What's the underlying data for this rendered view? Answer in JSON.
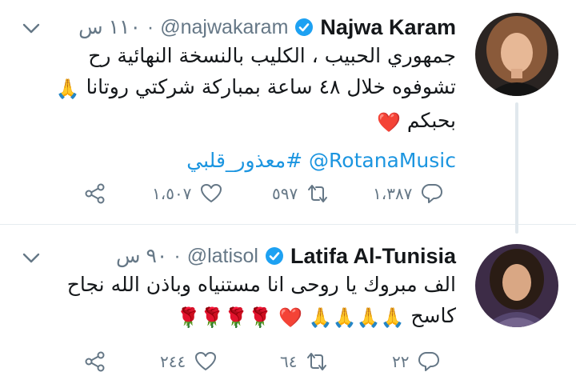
{
  "tweets": [
    {
      "name": "Najwa Karam",
      "handle": "@najwakaram",
      "time": "١١٠ س",
      "text_line1": "جمهوري الحبيب ، الكليب بالنسخة النهائية رح",
      "text_line2": "تشوفوه خلال ٤٨ ساعة  بمباركة شركتي روتانا",
      "text_line3": "بحبكم",
      "mention": "@RotanaMusic",
      "hashtag": "#معذور_قلبي",
      "emoji_pray": "🙏",
      "emoji_heart": "❤️",
      "reply_count": "١،٣٨٧",
      "retweet_count": "٥٩٧",
      "like_count": "١،٥٠٧"
    },
    {
      "name": "Latifa Al-Tunisia",
      "handle": "@latisol",
      "time": "٩٠ س",
      "text_line1": "الف مبروك يا روحى انا مستنياه وباذن الله نجاح",
      "text_line2": "كاسح",
      "emoji_pray": "🙏",
      "emoji_heart": "❤️",
      "emoji_rose": "🌹",
      "reply_count": "٢٢",
      "retweet_count": "٦٤",
      "like_count": "٢٤٤"
    }
  ],
  "colors": {
    "text": "#14171a",
    "secondary": "#657786",
    "link": "#1b95e0",
    "verified": "#1da1f2",
    "divider": "#e6ecf0"
  },
  "icons": [
    "reply-icon",
    "retweet-icon",
    "like-icon",
    "share-icon",
    "verified-badge-icon",
    "chevron-down-icon"
  ]
}
